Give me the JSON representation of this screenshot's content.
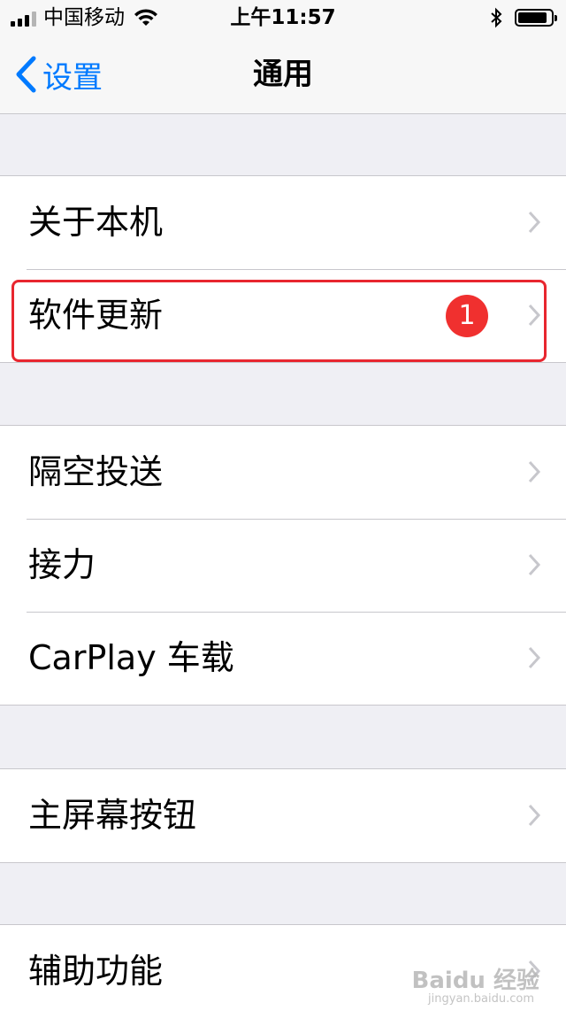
{
  "status_bar": {
    "carrier": "中国移动",
    "time": "上午11:57",
    "battery_level": 0.9
  },
  "nav": {
    "back_label": "设置",
    "title": "通用"
  },
  "groups": [
    {
      "rows": [
        {
          "label": "关于本机"
        },
        {
          "label": "软件更新",
          "badge": "1"
        }
      ]
    },
    {
      "rows": [
        {
          "label": "隔空投送"
        },
        {
          "label": "接力"
        },
        {
          "label": "CarPlay 车载"
        }
      ]
    },
    {
      "rows": [
        {
          "label": "主屏幕按钮"
        }
      ]
    },
    {
      "rows": [
        {
          "label": "辅助功能"
        }
      ]
    }
  ],
  "colors": {
    "accent": "#007aff",
    "badge": "#f0302f",
    "highlight": "#e8262f",
    "background": "#efeff4"
  },
  "icons": [
    "signal-icon",
    "wifi-icon",
    "bluetooth-icon",
    "battery-icon",
    "back-chevron-icon",
    "chevron-right-icon"
  ],
  "watermark": {
    "text": "Baidu 经验",
    "sub": "jingyan.baidu.com"
  }
}
